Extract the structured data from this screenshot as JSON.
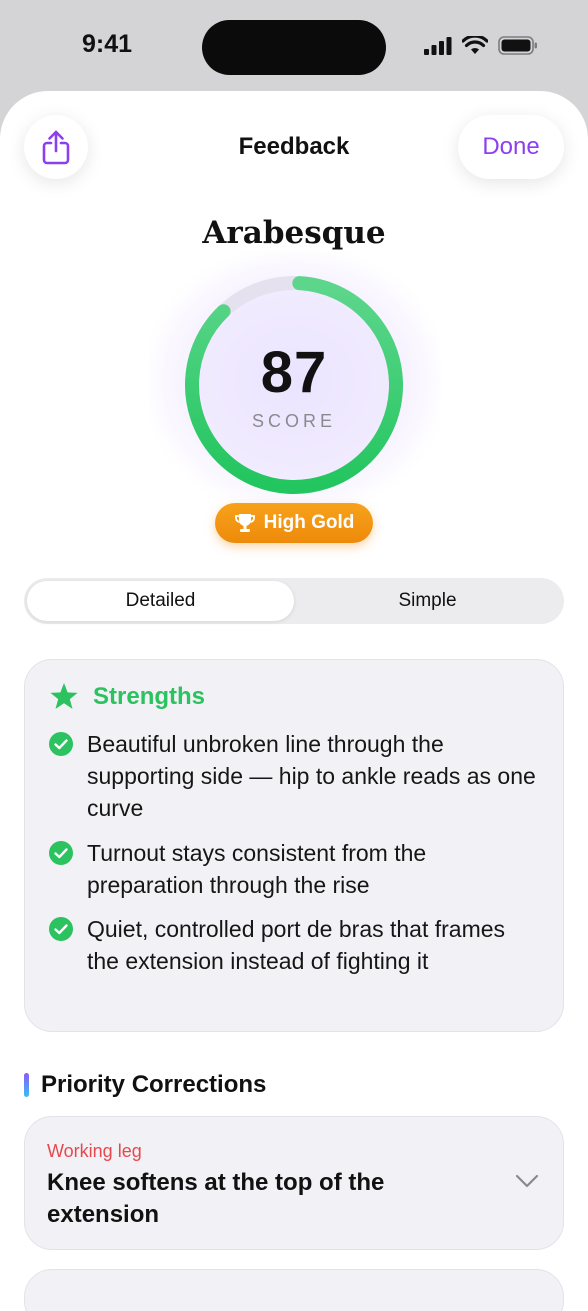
{
  "status_bar": {
    "time": "9:41"
  },
  "header": {
    "title": "Feedback",
    "done_label": "Done"
  },
  "score": {
    "pose": "Arabesque",
    "value": "87",
    "label": "SCORE",
    "progress": 0.87,
    "badge": "High Gold"
  },
  "tabs": [
    {
      "label": "Detailed",
      "active": true
    },
    {
      "label": "Simple",
      "active": false
    }
  ],
  "strengths": {
    "title": "Strengths",
    "items": [
      "Beautiful unbroken line through the supporting side — hip to ankle reads as one curve",
      "Turnout stays consistent from the preparation through the rise",
      "Quiet, controlled port de bras that frames the extension instead of fighting it"
    ]
  },
  "corrections": {
    "title": "Priority Corrections",
    "items": [
      {
        "tag": "Working leg",
        "title": "Knee softens at the top of the extension"
      }
    ]
  },
  "colors": {
    "accent": "#8b3ff0",
    "strength": "#2bc25f",
    "badge": "#f29a14",
    "correction_tag": "#e5484d",
    "ring": "#2fcf6a"
  },
  "icons": {
    "share": "share-icon",
    "trophy": "trophy-icon",
    "star": "star-icon",
    "check": "checkmark-circle-icon",
    "chevron": "chevron-down-icon"
  }
}
